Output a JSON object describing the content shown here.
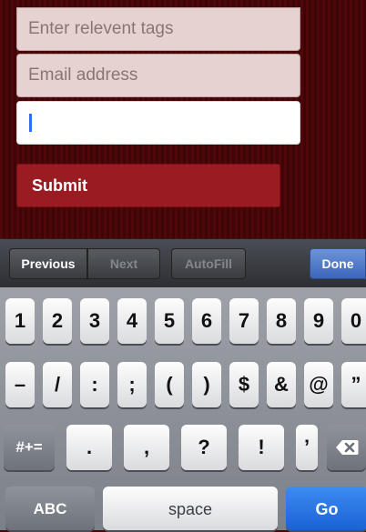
{
  "form": {
    "tags_placeholder": "Enter relevent tags",
    "email_placeholder": "Email address",
    "active_value": "",
    "submit_label": "Submit"
  },
  "assistant": {
    "previous": "Previous",
    "next": "Next",
    "autofill": "AutoFill",
    "done": "Done"
  },
  "keyboard": {
    "row1": [
      "1",
      "2",
      "3",
      "4",
      "5",
      "6",
      "7",
      "8",
      "9",
      "0"
    ],
    "row2": [
      "–",
      "/",
      ":",
      ";",
      "(",
      ")",
      "$",
      "&",
      "@",
      "”"
    ],
    "row3": [
      ".",
      ",",
      "?",
      "!",
      "’"
    ],
    "shift_label": "#+=",
    "abc_label": "ABC",
    "space_label": "space",
    "go_label": "Go"
  },
  "colors": {
    "background": "#4b0707",
    "submit": "#9b1b22",
    "done": "#3c66bb",
    "go": "#1a62d6",
    "caret": "#2f6ef0"
  }
}
